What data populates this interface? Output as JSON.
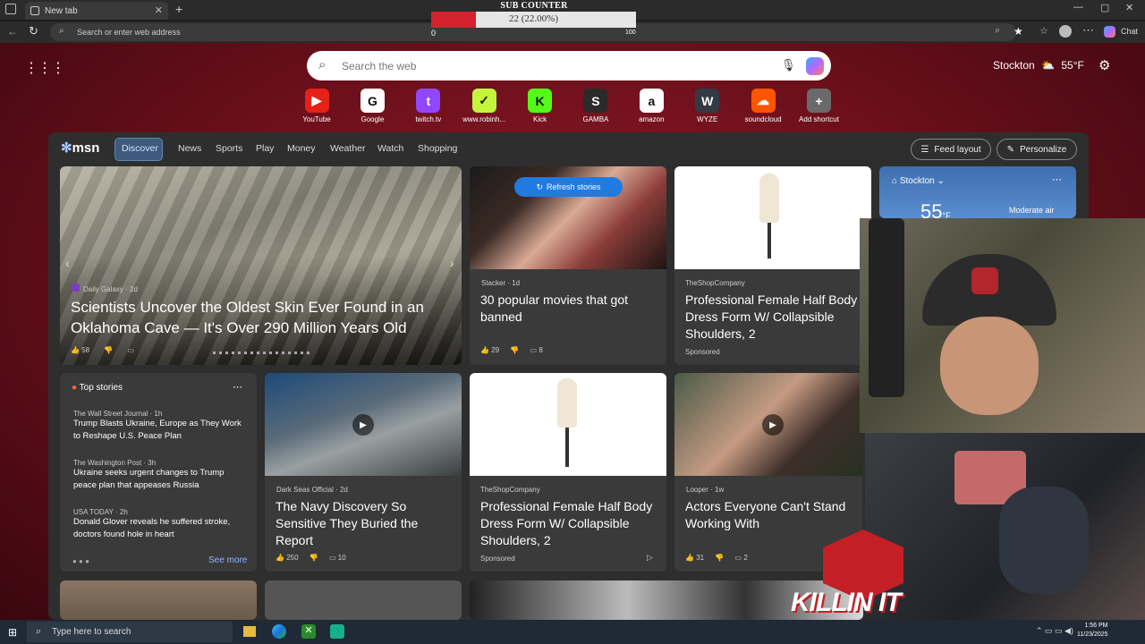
{
  "browser": {
    "tab_title": "New tab",
    "address_placeholder": "Search or enter web address",
    "chat_label": "Chat"
  },
  "sub_counter": {
    "title": "SUB COUNTER",
    "value_text": "22 (22.00%)",
    "progress": 0.22,
    "min": "0",
    "max": "100",
    "fill_color": "#d4222e"
  },
  "newtab": {
    "search_placeholder": "Search the web",
    "location": "Stockton",
    "temperature": "55°F",
    "shortcuts": [
      {
        "label": "YouTube",
        "icon": "youtube-icon",
        "color": "#e62117",
        "glyph": "▶"
      },
      {
        "label": "Google",
        "icon": "google-icon",
        "color": "#ffffff",
        "glyph": "G"
      },
      {
        "label": "twitch.tv",
        "icon": "twitch-icon",
        "color": "#9146ff",
        "glyph": "t"
      },
      {
        "label": "www.robinh...",
        "icon": "robinhood-icon",
        "color": "#c3f53c",
        "glyph": "✓"
      },
      {
        "label": "Kick",
        "icon": "kick-icon",
        "color": "#53fc18",
        "glyph": "K"
      },
      {
        "label": "GAMBA",
        "icon": "gamba-icon",
        "color": "#2a2a2a",
        "glyph": "S"
      },
      {
        "label": "amazon",
        "icon": "amazon-icon",
        "color": "#ffffff",
        "glyph": "a"
      },
      {
        "label": "WYZE",
        "icon": "wyze-icon",
        "color": "#333a44",
        "glyph": "W"
      },
      {
        "label": "soundcloud",
        "icon": "soundcloud-icon",
        "color": "#ff5500",
        "glyph": "☁"
      },
      {
        "label": "Add shortcut",
        "icon": "plus-icon",
        "color": "#6a6a6a",
        "glyph": "+"
      }
    ]
  },
  "msn": {
    "logo": "msn",
    "nav": [
      "Discover",
      "News",
      "Sports",
      "Play",
      "Money",
      "Weather",
      "Watch",
      "Shopping"
    ],
    "feed_layout": "Feed layout",
    "personalize": "Personalize",
    "refresh": "Refresh stories",
    "hero": {
      "source": "Daily Galaxy",
      "age": "2d",
      "title": "Scientists Uncover the Oldest Skin Ever Found in an Oklahoma Cave — It's Over 290 Million Years Old",
      "likes": "58"
    },
    "card_movies": {
      "source": "Stacker",
      "age": "1d",
      "title": "30 popular movies that got banned",
      "likes": "29",
      "comments": "8"
    },
    "card_shop1": {
      "source": "TheShopCompany",
      "title": "Professional Female Half Body Dress Form W/ Collapsible Shoulders, 2",
      "tag": "Sponsored"
    },
    "weather_card": {
      "location": "Stockton",
      "air": "Moderate air",
      "temp": "55",
      "unit": "°F"
    },
    "top_stories": {
      "heading": "Top stories",
      "items": [
        {
          "source": "The Wall Street Journal",
          "age": "1h",
          "title": "Trump Blasts Ukraine, Europe as They Work to Reshape U.S. Peace Plan"
        },
        {
          "source": "The Washington Post",
          "age": "3h",
          "title": "Ukraine seeks urgent changes to Trump peace plan that appeases Russia"
        },
        {
          "source": "USA TODAY",
          "age": "2h",
          "title": "Donald Glover reveals he suffered stroke, doctors found hole in heart"
        }
      ],
      "see_more": "See more"
    },
    "card_navy": {
      "source": "Dark Seas Official",
      "age": "2d",
      "title": "The Navy Discovery So Sensitive They Buried the Report",
      "likes": "250",
      "comments": "10"
    },
    "card_shop2": {
      "source": "TheShopCompany",
      "title": "Professional Female Half Body Dress Form W/ Collapsible Shoulders, 2",
      "tag": "Sponsored"
    },
    "card_actors": {
      "source": "Looper",
      "age": "1w",
      "title": "Actors Everyone Can't Stand Working With",
      "likes": "31",
      "comments": "2"
    }
  },
  "overlay": {
    "brand": "KILLIN IT"
  },
  "taskbar": {
    "search_placeholder": "Type here to search",
    "time": "1:56 PM",
    "date": "11/23/2025"
  }
}
